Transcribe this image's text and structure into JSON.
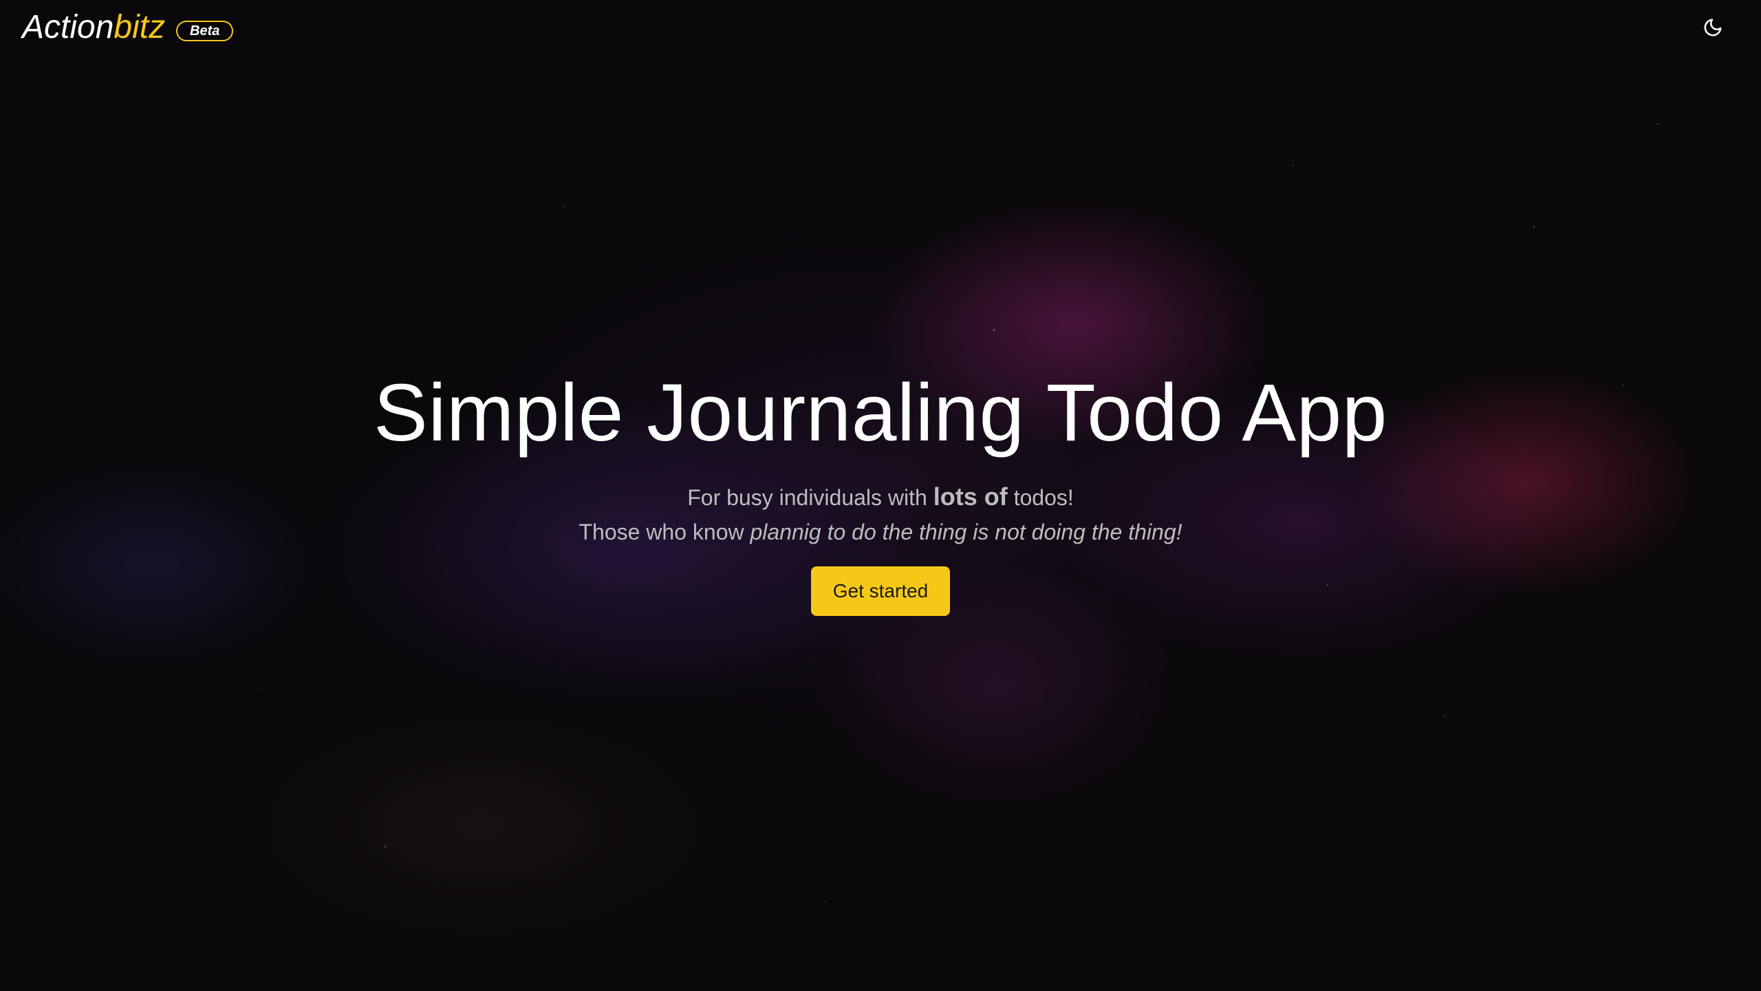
{
  "header": {
    "logo_primary": "Action",
    "logo_accent": "bitz",
    "badge": "Beta",
    "theme_toggle_icon": "moon-icon"
  },
  "hero": {
    "title": "Simple Journaling Todo App",
    "tagline_1_pre": "For busy individuals with ",
    "tagline_1_strong": "lots of",
    "tagline_1_post": " todos!",
    "tagline_2_pre": "Those who know ",
    "tagline_2_em": "plannig to do the thing is not doing the thing!",
    "cta_label": "Get started"
  },
  "colors": {
    "accent": "#f5c818",
    "background": "#0a080b",
    "text": "#ffffff",
    "muted_text": "#bdbdbd"
  }
}
